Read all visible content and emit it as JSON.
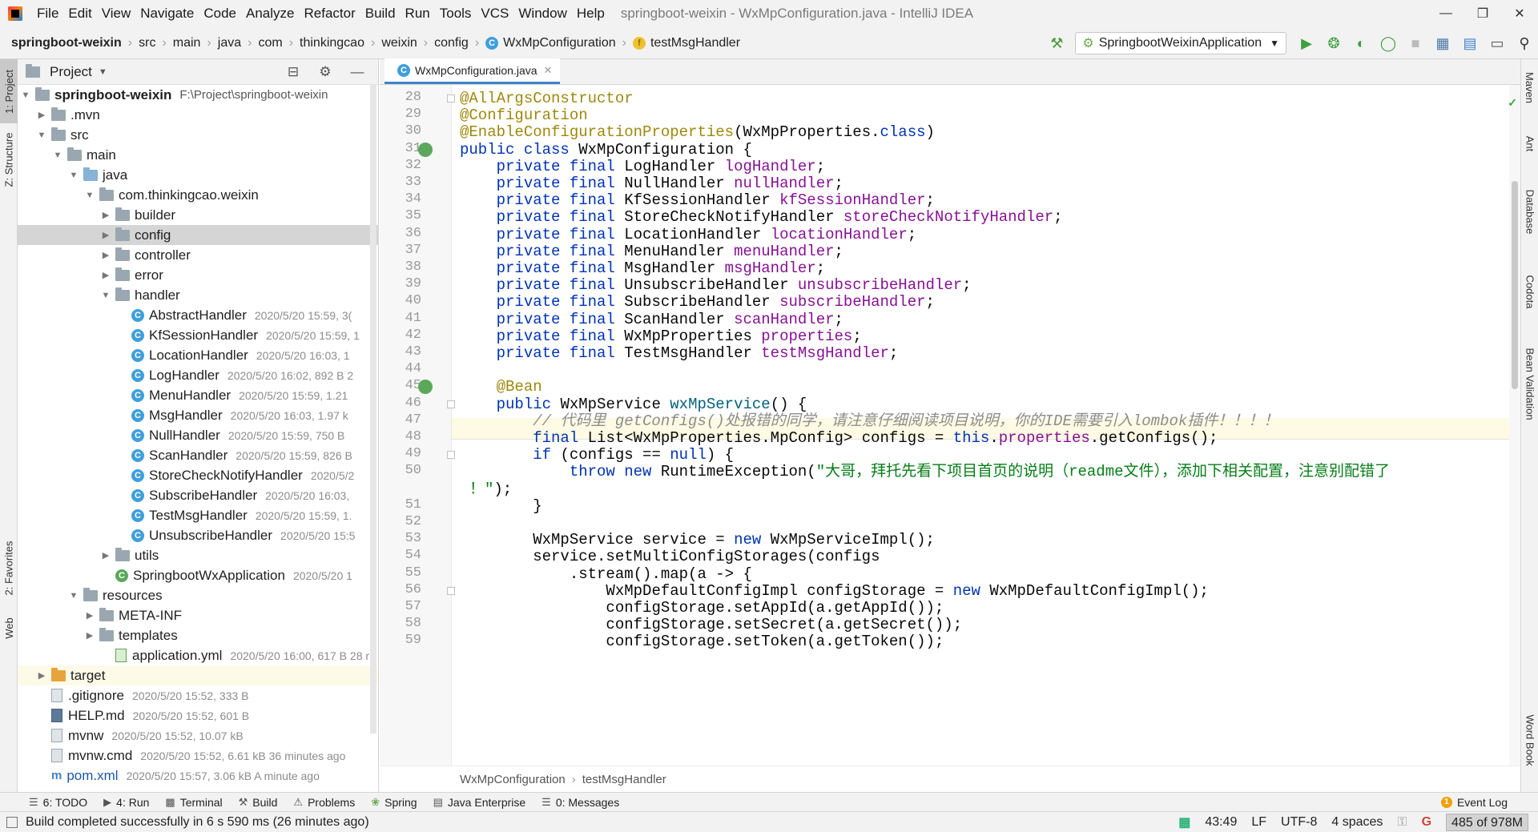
{
  "menu": {
    "items": [
      "File",
      "Edit",
      "View",
      "Navigate",
      "Code",
      "Analyze",
      "Refactor",
      "Build",
      "Run",
      "Tools",
      "VCS",
      "Window",
      "Help"
    ],
    "title": "springboot-weixin - WxMpConfiguration.java - IntelliJ IDEA"
  },
  "breadcrumbs": [
    "springboot-weixin",
    "src",
    "main",
    "java",
    "com",
    "thinkingcao",
    "weixin",
    "config",
    "WxMpConfiguration",
    "testMsgHandler"
  ],
  "run_config": "SpringbootWeixinApplication",
  "project_panel": {
    "title": "Project",
    "root_name": "springboot-weixin",
    "root_path": "F:\\Project\\springboot-weixin",
    "nodes": [
      {
        "label": "springboot-weixin",
        "meta": "F:\\Project\\springboot-weixin"
      },
      {
        "label": ".mvn",
        "meta": ""
      },
      {
        "label": "src",
        "meta": ""
      },
      {
        "label": "main",
        "meta": ""
      },
      {
        "label": "java",
        "meta": ""
      },
      {
        "label": "com.thinkingcao.weixin",
        "meta": ""
      },
      {
        "label": "builder",
        "meta": ""
      },
      {
        "label": "config",
        "meta": ""
      },
      {
        "label": "controller",
        "meta": ""
      },
      {
        "label": "error",
        "meta": ""
      },
      {
        "label": "handler",
        "meta": ""
      },
      {
        "label": "AbstractHandler",
        "meta": "2020/5/20 15:59, 3("
      },
      {
        "label": "KfSessionHandler",
        "meta": "2020/5/20 15:59, 1"
      },
      {
        "label": "LocationHandler",
        "meta": "2020/5/20 16:03, 1"
      },
      {
        "label": "LogHandler",
        "meta": "2020/5/20 16:02, 892 B 2"
      },
      {
        "label": "MenuHandler",
        "meta": "2020/5/20 15:59, 1.21"
      },
      {
        "label": "MsgHandler",
        "meta": "2020/5/20 16:03, 1.97 k"
      },
      {
        "label": "NullHandler",
        "meta": "2020/5/20 15:59, 750 B"
      },
      {
        "label": "ScanHandler",
        "meta": "2020/5/20 15:59, 826 B"
      },
      {
        "label": "StoreCheckNotifyHandler",
        "meta": "2020/5/2"
      },
      {
        "label": "SubscribeHandler",
        "meta": "2020/5/20 16:03,"
      },
      {
        "label": "TestMsgHandler",
        "meta": "2020/5/20 15:59, 1."
      },
      {
        "label": "UnsubscribeHandler",
        "meta": "2020/5/20 15:5"
      },
      {
        "label": "utils",
        "meta": ""
      },
      {
        "label": "SpringbootWxApplication",
        "meta": "2020/5/20 1"
      },
      {
        "label": "resources",
        "meta": ""
      },
      {
        "label": "META-INF",
        "meta": ""
      },
      {
        "label": "templates",
        "meta": ""
      },
      {
        "label": "application.yml",
        "meta": "2020/5/20 16:00, 617 B 28 r"
      },
      {
        "label": "target",
        "meta": ""
      },
      {
        "label": ".gitignore",
        "meta": "2020/5/20 15:52, 333 B"
      },
      {
        "label": "HELP.md",
        "meta": "2020/5/20 15:52, 601 B"
      },
      {
        "label": "mvnw",
        "meta": "2020/5/20 15:52, 10.07 kB"
      },
      {
        "label": "mvnw.cmd",
        "meta": "2020/5/20 15:52, 6.61 kB 36 minutes ago"
      },
      {
        "label": "pom.xml",
        "meta": "2020/5/20 15:57, 3.06 kB A minute ago"
      }
    ]
  },
  "editor": {
    "tab_label": "WxMpConfiguration.java",
    "line_numbers": [
      "28",
      "29",
      "30",
      "31",
      "32",
      "33",
      "34",
      "35",
      "36",
      "37",
      "38",
      "39",
      "40",
      "41",
      "42",
      "43",
      "44",
      "45",
      "46",
      "47",
      "48",
      "49",
      "50",
      "",
      "51",
      "52",
      "53",
      "54",
      "55",
      "56",
      "57",
      "58",
      "59"
    ],
    "footer_crumbs": [
      "WxMpConfiguration",
      "testMsgHandler"
    ]
  },
  "left_tabs": [
    "1: Project",
    "Z: Structure",
    "2: Favorites",
    "Web"
  ],
  "right_tabs": [
    "Maven",
    "Ant",
    "Database",
    "Codota",
    "Bean Validation",
    "Word Book"
  ],
  "bottom_tools": [
    "6: TODO",
    "4: Run",
    "Terminal",
    "Build",
    "Problems",
    "Spring",
    "Java Enterprise",
    "0: Messages"
  ],
  "event_log": "Event Log",
  "status": {
    "message": "Build completed successfully in 6 s 590 ms (26 minutes ago)",
    "position": "43:49",
    "line_sep": "LF",
    "encoding": "UTF-8",
    "indent": "4 spaces",
    "memory": "485 of 978M"
  },
  "code_lines": [
    [
      [
        "ann",
        "@AllArgsConstructor"
      ]
    ],
    [
      [
        "ann",
        "@Configuration"
      ]
    ],
    [
      [
        "ann",
        "@EnableConfigurationProperties"
      ],
      [
        "",
        "(WxMpProperties."
      ],
      [
        "kw",
        "class"
      ],
      [
        "",
        ")"
      ]
    ],
    [
      [
        "kw",
        "public class "
      ],
      [
        "",
        "WxMpConfiguration {"
      ]
    ],
    [
      [
        "",
        "    "
      ],
      [
        "kw",
        "private final "
      ],
      [
        "",
        "LogHandler "
      ],
      [
        "fld",
        "logHandler"
      ],
      [
        "",
        ";"
      ]
    ],
    [
      [
        "",
        "    "
      ],
      [
        "kw",
        "private final "
      ],
      [
        "",
        "NullHandler "
      ],
      [
        "fld",
        "nullHandler"
      ],
      [
        "",
        ";"
      ]
    ],
    [
      [
        "",
        "    "
      ],
      [
        "kw",
        "private final "
      ],
      [
        "",
        "KfSessionHandler "
      ],
      [
        "fld",
        "kfSessionHandler"
      ],
      [
        "",
        ";"
      ]
    ],
    [
      [
        "",
        "    "
      ],
      [
        "kw",
        "private final "
      ],
      [
        "",
        "StoreCheckNotifyHandler "
      ],
      [
        "fld",
        "storeCheckNotifyHandler"
      ],
      [
        "",
        ";"
      ]
    ],
    [
      [
        "",
        "    "
      ],
      [
        "kw",
        "private final "
      ],
      [
        "",
        "LocationHandler "
      ],
      [
        "fld",
        "locationHandler"
      ],
      [
        "",
        ";"
      ]
    ],
    [
      [
        "",
        "    "
      ],
      [
        "kw",
        "private final "
      ],
      [
        "",
        "MenuHandler "
      ],
      [
        "fld",
        "menuHandler"
      ],
      [
        "",
        ";"
      ]
    ],
    [
      [
        "",
        "    "
      ],
      [
        "kw",
        "private final "
      ],
      [
        "",
        "MsgHandler "
      ],
      [
        "fld",
        "msgHandler"
      ],
      [
        "",
        ";"
      ]
    ],
    [
      [
        "",
        "    "
      ],
      [
        "kw",
        "private final "
      ],
      [
        "",
        "UnsubscribeHandler "
      ],
      [
        "fld",
        "unsubscribeHandler"
      ],
      [
        "",
        ";"
      ]
    ],
    [
      [
        "",
        "    "
      ],
      [
        "kw",
        "private final "
      ],
      [
        "",
        "SubscribeHandler "
      ],
      [
        "fld",
        "subscribeHandler"
      ],
      [
        "",
        ";"
      ]
    ],
    [
      [
        "",
        "    "
      ],
      [
        "kw",
        "private final "
      ],
      [
        "",
        "ScanHandler "
      ],
      [
        "fld",
        "scanHandler"
      ],
      [
        "",
        ";"
      ]
    ],
    [
      [
        "",
        "    "
      ],
      [
        "kw",
        "private final "
      ],
      [
        "",
        "WxMpProperties "
      ],
      [
        "fld",
        "properties"
      ],
      [
        "",
        ";"
      ]
    ],
    [
      [
        "",
        "    "
      ],
      [
        "kw",
        "private final "
      ],
      [
        "",
        "TestMsgHandler "
      ],
      [
        "fld",
        "testMsgHandler"
      ],
      [
        "",
        ";"
      ]
    ],
    [
      [
        "",
        ""
      ]
    ],
    [
      [
        "",
        "    "
      ],
      [
        "ann",
        "@Bean"
      ]
    ],
    [
      [
        "",
        "    "
      ],
      [
        "kw",
        "public "
      ],
      [
        "",
        "WxMpService "
      ],
      [
        "mth",
        "wxMpService"
      ],
      [
        "",
        "() {"
      ]
    ],
    [
      [
        "",
        "        "
      ],
      [
        "cmt",
        "// 代码里 getConfigs()处报错的同学，请注意仔细阅读项目说明，你的IDE需要引入lombok插件！！！！"
      ]
    ],
    [
      [
        "",
        "        "
      ],
      [
        "kw",
        "final "
      ],
      [
        "",
        "List<WxMpProperties.MpConfig> configs = "
      ],
      [
        "kw",
        "this"
      ],
      [
        "",
        "."
      ],
      [
        "fld",
        "properties"
      ],
      [
        "",
        ".getConfigs();"
      ]
    ],
    [
      [
        "",
        "        "
      ],
      [
        "kw",
        "if "
      ],
      [
        "",
        "(configs == "
      ],
      [
        "kw",
        "null"
      ],
      [
        "",
        ") {"
      ]
    ],
    [
      [
        "",
        "            "
      ],
      [
        "kw",
        "throw new "
      ],
      [
        "",
        "RuntimeException("
      ],
      [
        "str",
        "\"大哥，拜托先看下项目首页的说明（readme文件），添加下相关配置，注意别配错了"
      ]
    ],
    [
      [
        "str",
        "！\""
      ],
      [
        "",
        ");"
      ]
    ],
    [
      [
        "",
        "        }"
      ]
    ],
    [
      [
        "",
        ""
      ]
    ],
    [
      [
        "",
        "        WxMpService service = "
      ],
      [
        "kw",
        "new "
      ],
      [
        "",
        "WxMpServiceImpl();"
      ]
    ],
    [
      [
        "",
        "        service.setMultiConfigStorages(configs"
      ]
    ],
    [
      [
        "",
        "            .stream().map(a -> {"
      ]
    ],
    [
      [
        "",
        "                WxMpDefaultConfigImpl configStorage = "
      ],
      [
        "kw",
        "new "
      ],
      [
        "",
        "WxMpDefaultConfigImpl();"
      ]
    ],
    [
      [
        "",
        "                configStorage.setAppId(a.getAppId());"
      ]
    ],
    [
      [
        "",
        "                configStorage.setSecret(a.getSecret());"
      ]
    ],
    [
      [
        "",
        "                configStorage.setToken(a.getToken());"
      ]
    ]
  ]
}
